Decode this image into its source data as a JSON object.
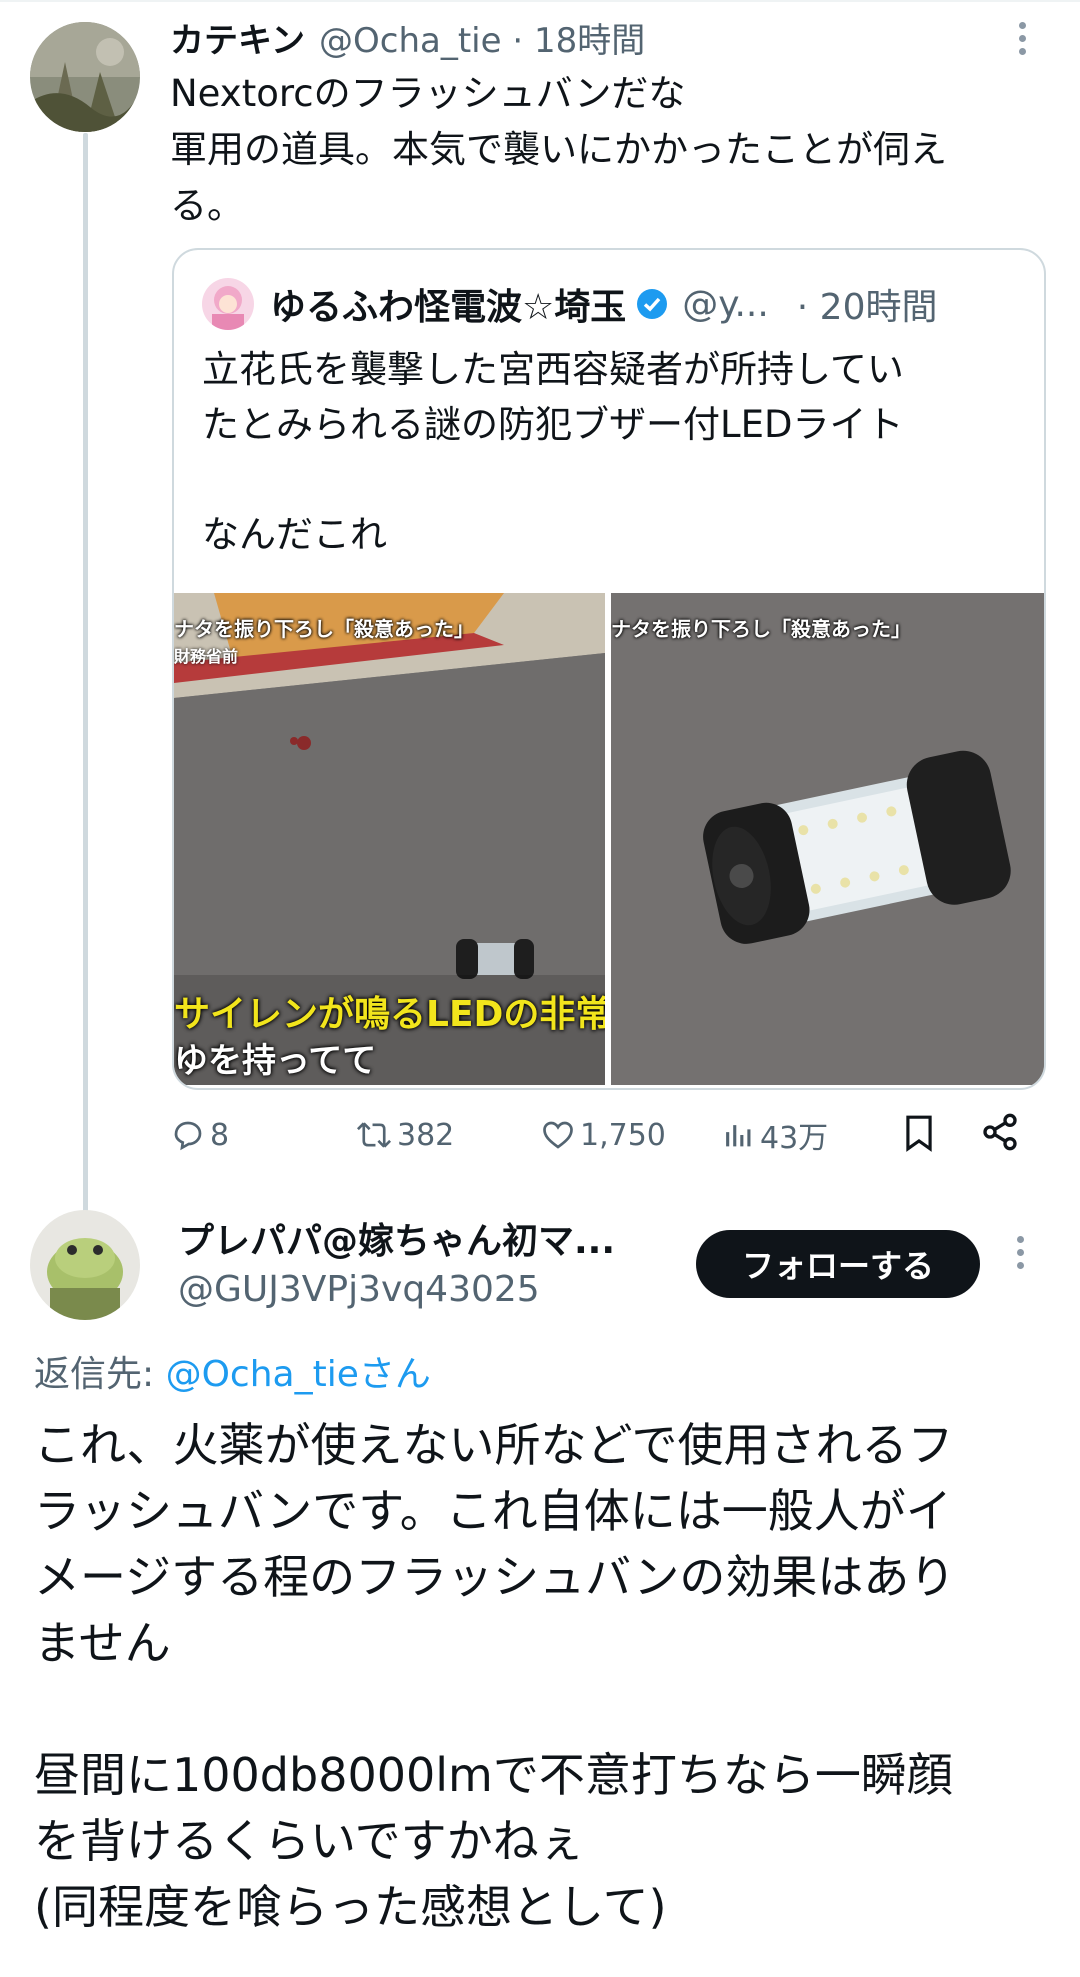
{
  "tweet1": {
    "display_name": "カテキン",
    "handle_time": "@Ocha_tie · 18時間",
    "text_lines": [
      "Nextorcのフラッシュバンだな",
      "軍用の道具。本気で襲いにかかったことが伺え",
      "る。"
    ]
  },
  "quoted": {
    "display_name": "ゆるふわ怪電波☆埼玉",
    "handle": "@y...",
    "time": "· 20時間",
    "text_lines": [
      "立花氏を襲撃した宮西容疑者が所持してい",
      "たとみられる謎の防犯ブザー付LEDライト",
      "",
      "なんだこれ"
    ],
    "image1": {
      "top_caption": "ナタを振り下ろし「殺意あった」",
      "sub_caption": "財務省前",
      "bottom_caption_1": "サイレンが鳴るLEDの非常ランプ",
      "bottom_caption_2": "ゆを持ってて"
    },
    "image2": {
      "top_caption": "ナタを振り下ろし「殺意あった」"
    }
  },
  "actions": {
    "replies": "8",
    "retweets": "382",
    "likes": "1,750",
    "views": "43万"
  },
  "reply": {
    "display_name": "プレパパ@嫁ちゃん初マ...",
    "handle": "@GUJ3VPj3vq43025",
    "follow_label": "フォローする",
    "replying_prefix": "返信先:",
    "replying_to": "@Ocha_tieさん",
    "text_lines": [
      "これ、火薬が使えない所などで使用されるフ",
      "ラッシュバンです。これ自体には一般人がイ",
      "メージする程のフラッシュバンの効果はあり",
      "ません",
      "",
      "昼間に100db8000lmで不意打ちなら一瞬顔",
      "を背けるくらいですかねぇ",
      "(同程度を喰らった感想として)"
    ]
  },
  "colors": {
    "text": "#0f1419",
    "secondary": "#536471",
    "link": "#1d9bf0",
    "verified": "#1d9bf0",
    "border": "#cfd9de",
    "follow_bg": "#0f1419",
    "caption_yellow": "#f2e51c",
    "caption_green": "#9be52a"
  }
}
